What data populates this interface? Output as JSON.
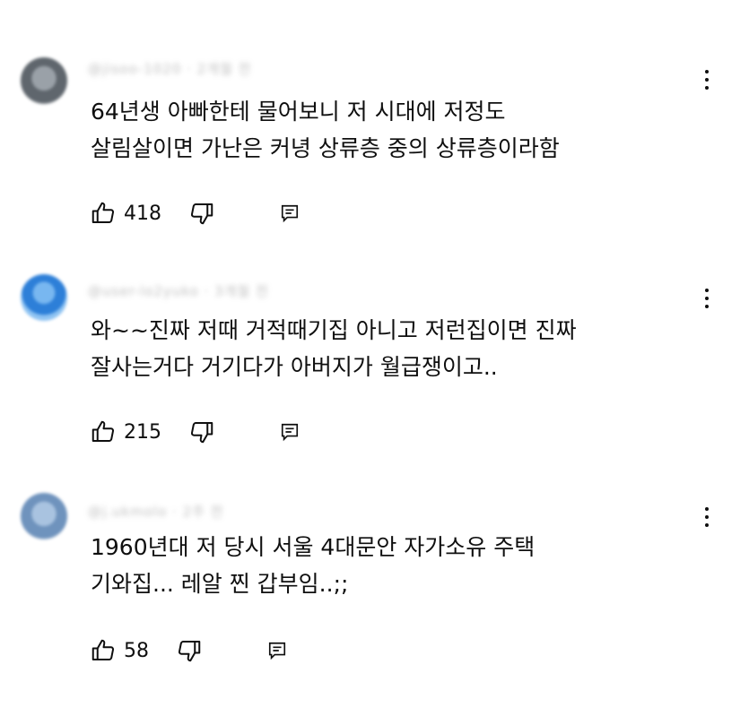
{
  "comments": [
    {
      "author": "@jisoo-1020 · 2개월 전",
      "text": "64년생 아빠한테 물어보니 저 시대에 저정도\n살림살이면 가난은 커녕 상류층 중의 상류층이라함",
      "likes": "418"
    },
    {
      "author": "@user-lo2yuko · 3개월 전",
      "text": "와~~진짜 저때 거적때기집 아니고 저런집이면 진짜\n잘사는거다 거기다가 아버지가 월급쟁이고..",
      "likes": "215"
    },
    {
      "author": "@j.ukmolo · 2주 전",
      "text": "1960년대 저 당시 서울 4대문안 자가소유 주택\n기와집... 레알 찐 갑부임..;;",
      "likes": "58"
    }
  ]
}
